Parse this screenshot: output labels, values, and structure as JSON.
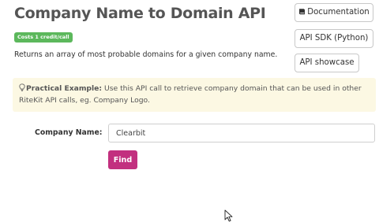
{
  "header": {
    "title": "Company Name to Domain API",
    "badge": "Costs 1 credit/call",
    "description": "Returns an array of most probable domains for a given company name."
  },
  "side_buttons": {
    "documentation": "Documentation",
    "sdk": "API SDK (Python)",
    "showcase": "API showcase"
  },
  "example": {
    "label": "Practical Example:",
    "text": " Use this API call to retrieve company domain that can be used in other RiteKit API calls, eg. Company Logo."
  },
  "form": {
    "company_label": "Company Name:",
    "company_value": "Clearbit",
    "submit_label": "Find"
  },
  "colors": {
    "badge_bg": "#5cb85c",
    "example_bg": "#fcf8e3",
    "find_bg": "#c2307f",
    "title": "#555555"
  },
  "icons": {
    "documentation": "book-icon",
    "example": "lightbulb-icon",
    "pointer": "mouse-cursor-icon"
  }
}
